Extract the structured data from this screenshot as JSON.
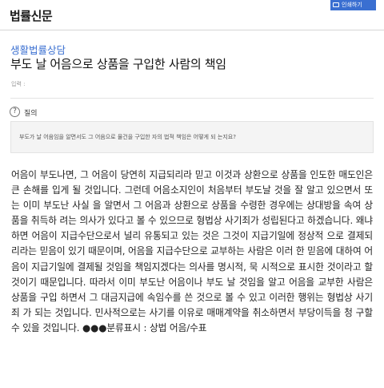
{
  "header": {
    "logo": "법률신문",
    "print_label": "인쇄하기"
  },
  "article": {
    "category": "생활법률상담",
    "title": "부도 날 어음으로 상품을 구입한 사람의 책임",
    "date_label": "입력 :",
    "question_label": "질의",
    "question_icon": "?",
    "question_text": "부도가 날 어음임을 알면서도 그 어음으로 물건을 구입한 자의 법적 책임은 어떻게 되 는지요?",
    "answer_text": "어음이 부도나면, 그 어음이 당연히 지급되리라 믿고 이것과 상환으로 상품을 인도한 매도인은 큰 손해를 입게 될 것입니다. 그런데 어음소지인이 처음부터 부도날 것을 잘 알고 있으면서 또는 이미 부도난 사실 을 알면서 그 어음과 상환으로 상품을 수령한 경우에는 상대방을 속여 상품을 취득하 려는 의사가 있다고 볼 수 있으므로 형법상 사기죄가 성립된다고 하겠습니다. 왜냐하면 어음이 지급수단으로서 널리 유통되고 있는 것은 그것이 지급기일에 정상적 으로 결제되리라는 믿음이 있기 때문이며, 어음을 지급수단으로 교부하는 사람은 이러 한 믿음에 대하여 어음이 지급기일에 결제될 것임을 책임지겠다는 의사를 명시적, 묵 시적으로 표시한 것이라고 할 것이기 때문입니다. 따라서 이미 부도난 어음이나 부도 날 것임을 알고 어음을 교부한 사람은 상품을 구입 하면서 그 대금지급에 속임수를 쓴 것으로 볼 수 있고 이러한 행위는 형법상 사기죄 가 되는 것입니다. 민사적으로는 사기를 이유로 매매계약을 취소하면서 부당이득을 청 구할 수 있을 것입니다. ●●●분류표시 : 상법 어음/수표"
  }
}
